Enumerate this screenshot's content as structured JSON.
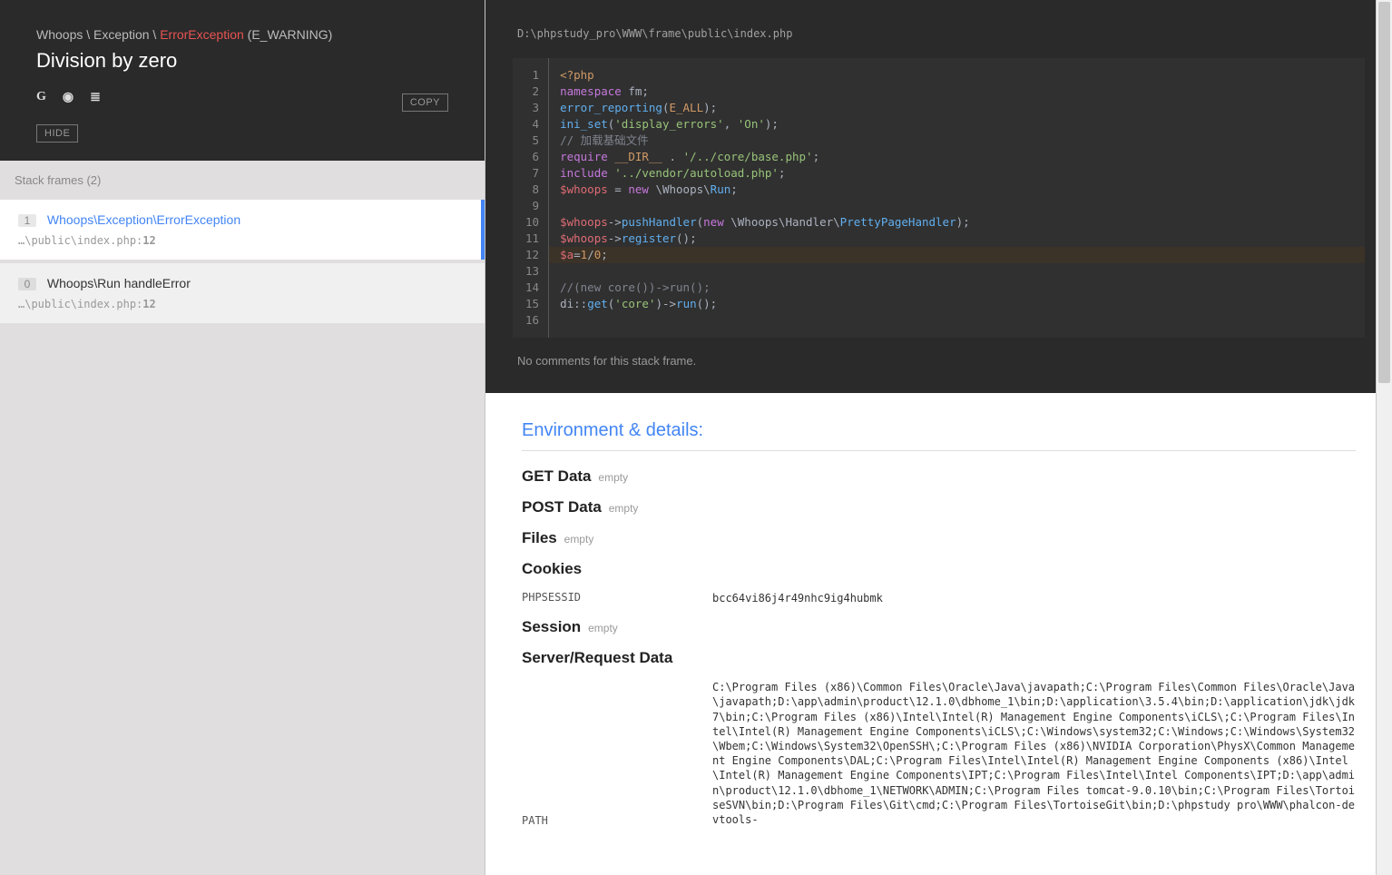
{
  "header": {
    "breadcrumb_1": "Whoops",
    "breadcrumb_2": "Exception",
    "breadcrumb_3": "ErrorException",
    "severity": "(E_WARNING)",
    "title": "Division by zero",
    "search_google": "G",
    "search_duck": "◉",
    "search_stack": "≣",
    "copy_label": "COPY",
    "hide_label": "HIDE"
  },
  "stack": {
    "title": "Stack frames (2)",
    "frames": [
      {
        "n": "1",
        "class": "Whoops\\Exception\\ErrorException",
        "file": "…\\public\\index.php",
        "line": "12",
        "active": true
      },
      {
        "n": "0",
        "class": "Whoops\\Run handleError",
        "file": "…\\public\\index.php",
        "line": "12",
        "active": false
      }
    ]
  },
  "code": {
    "filepath": "D:\\phpstudy_pro\\WWW\\frame\\public\\index.php",
    "no_comments": "No comments for this stack frame.",
    "highlight_line": 12
  },
  "env": {
    "title": "Environment & details:",
    "get_label": "GET Data",
    "post_label": "POST Data",
    "files_label": "Files",
    "session_label": "Session",
    "empty": "empty",
    "cookies_label": "Cookies",
    "cookies": [
      {
        "k": "PHPSESSID",
        "v": "bcc64vi86j4r49nhc9ig4hubmk"
      }
    ],
    "server_label": "Server/Request Data",
    "server": [
      {
        "k": "PATH",
        "v": "C:\\Program Files (x86)\\Common Files\\Oracle\\Java\\javapath;C:\\Program Files\\Common Files\\Oracle\\Java\\javapath;D:\\app\\admin\\product\\12.1.0\\dbhome_1\\bin;D:\\application\\3.5.4\\bin;D:\\application\\jdk\\jdk7\\bin;C:\\Program Files (x86)\\Intel\\Intel(R) Management Engine Components\\iCLS\\;C:\\Program Files\\Intel\\Intel(R) Management Engine Components\\iCLS\\;C:\\Windows\\system32;C:\\Windows;C:\\Windows\\System32\\Wbem;C:\\Windows\\System32\\OpenSSH\\;C:\\Program Files (x86)\\NVIDIA Corporation\\PhysX\\Common Management Engine Components\\DAL;C:\\Program Files\\Intel\\Intel(R) Management Engine Components (x86)\\Intel\\Intel(R) Management Engine Components\\IPT;C:\\Program Files\\Intel\\Intel Components\\IPT;D:\\app\\admin\\product\\12.1.0\\dbhome_1\\NETWORK\\ADMIN;C:\\Program Files tomcat-9.0.10\\bin;C:\\Program Files\\TortoiseSVN\\bin;D:\\Program Files\\Git\\cmd;C:\\Program Files\\TortoiseGit\\bin;D:\\phpstudy pro\\WWW\\phalcon-devtools-"
      }
    ]
  }
}
